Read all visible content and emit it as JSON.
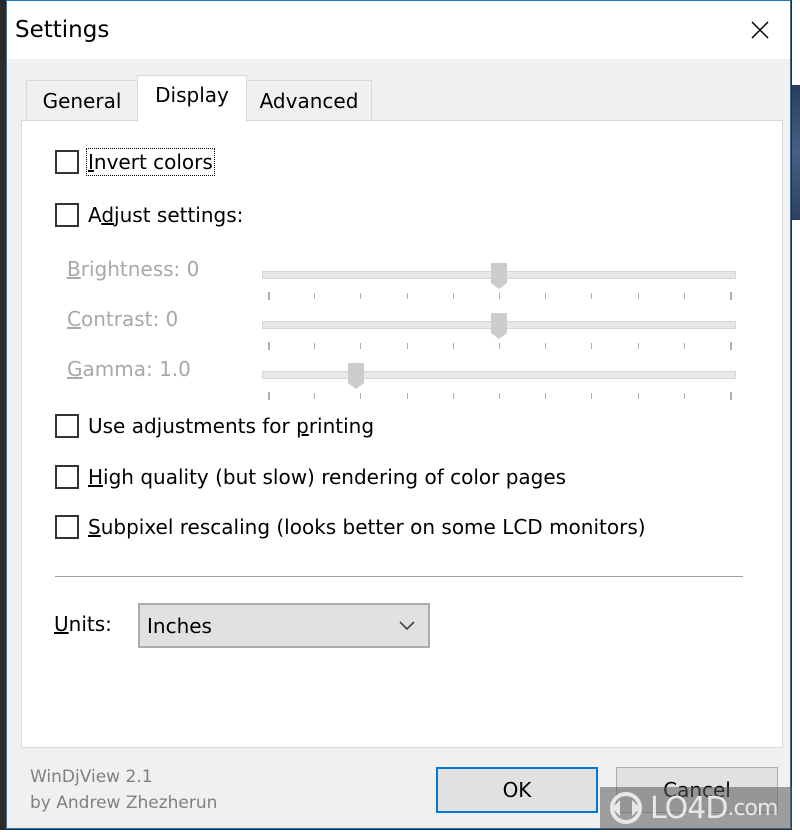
{
  "window": {
    "title": "Settings",
    "close_icon": "close-icon"
  },
  "tabs": [
    {
      "label": "General",
      "active": false
    },
    {
      "label": "Display",
      "active": true
    },
    {
      "label": "Advanced",
      "active": false
    }
  ],
  "display": {
    "invert_colors": {
      "label_prefix": "",
      "mnemonic": "I",
      "label_rest": "nvert colors",
      "checked": false,
      "focused": true
    },
    "adjust_settings": {
      "label_prefix": "A",
      "mnemonic": "d",
      "label_rest": "just settings:",
      "checked": false
    },
    "sliders": [
      {
        "mnemonic": "B",
        "label_rest": "rightness: 0",
        "name": "brightness",
        "value": 0,
        "position_fraction": 0.5,
        "tick_count": 11,
        "enabled": false
      },
      {
        "mnemonic": "C",
        "label_rest": "ontrast: 0",
        "name": "contrast",
        "value": 0,
        "position_fraction": 0.5,
        "tick_count": 11,
        "enabled": false
      },
      {
        "mnemonic": "G",
        "label_rest": "amma: 1.0",
        "name": "gamma",
        "value": 1.0,
        "position_fraction": 0.19,
        "tick_count": 11,
        "enabled": false
      }
    ],
    "use_for_printing": {
      "label_prefix": "Use adjustments for ",
      "mnemonic": "p",
      "label_rest": "rinting",
      "checked": false
    },
    "high_quality": {
      "label_prefix": "",
      "mnemonic": "H",
      "label_rest": "igh quality (but slow) rendering of color pages",
      "checked": false
    },
    "subpixel": {
      "label_prefix": "",
      "mnemonic": "S",
      "label_rest": "ubpixel rescaling (looks better on some LCD monitors)",
      "checked": false
    },
    "units": {
      "mnemonic": "U",
      "label_rest": "nits:",
      "value": "Inches"
    }
  },
  "footer": {
    "app_name": "WinDjView 2.1",
    "author": "by Andrew Zhezherun",
    "ok_label": "OK",
    "cancel_label": "Cancel"
  },
  "watermark": {
    "text": "LO4D",
    "suffix": ".com"
  },
  "colors": {
    "accent": "#0078d7",
    "window_border": "#1979ca",
    "disabled_text": "#a8a8a8",
    "panel_bg": "#ffffff",
    "dialog_bg": "#f0f0f0"
  }
}
